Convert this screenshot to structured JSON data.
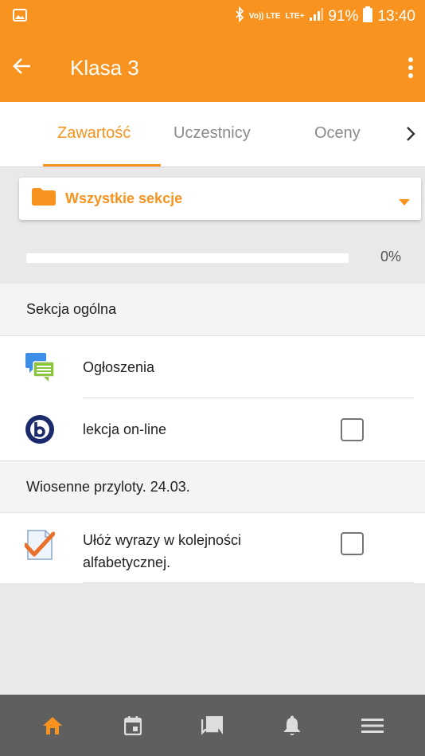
{
  "status_bar": {
    "volte_label": "Vo)) LTE",
    "lte_label": "LTE+",
    "battery": "91%",
    "time": "13:40"
  },
  "app_bar": {
    "title": "Klasa 3"
  },
  "tabs": [
    {
      "label": "Zawartość",
      "active": true
    },
    {
      "label": "Uczestnicy",
      "active": false
    },
    {
      "label": "Oceny",
      "active": false
    }
  ],
  "section_filter": {
    "label": "Wszystkie sekcje"
  },
  "progress": {
    "value": 0,
    "label": "0%"
  },
  "sections": [
    {
      "title": "Sekcja ogólna",
      "items": [
        {
          "label": "Ogłoszenia",
          "icon": "forum-icon",
          "has_checkbox": false
        },
        {
          "label": "lekcja on-line",
          "icon": "bigbluebutton-icon",
          "has_checkbox": true,
          "checked": false
        }
      ]
    },
    {
      "title": "Wiosenne przyloty. 24.03.",
      "items": [
        {
          "label": "Ułóż wyrazy w kolejności alfabetycznej.",
          "icon": "assignment-icon",
          "has_checkbox": true,
          "checked": false
        }
      ]
    }
  ],
  "bottom_nav": [
    {
      "name": "home",
      "active": true
    },
    {
      "name": "calendar",
      "active": false
    },
    {
      "name": "messages",
      "active": false
    },
    {
      "name": "notifications",
      "active": false
    },
    {
      "name": "menu",
      "active": false
    }
  ],
  "colors": {
    "accent": "#f7931e",
    "bottom_nav_bg": "#5f5f5f"
  }
}
